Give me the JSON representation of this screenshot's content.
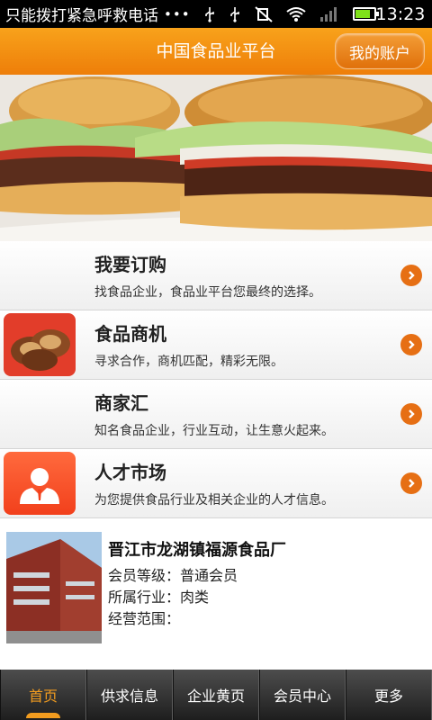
{
  "status_bar": {
    "carrier_text": "只能拨打紧急呼救电话",
    "more_dots": "•••",
    "time": "13:23",
    "icons": [
      "usb-icon",
      "usb-icon",
      "mute-icon",
      "wifi-icon",
      "signal-icon",
      "battery-icon"
    ]
  },
  "header": {
    "title": "中国食品业平台",
    "account_button": "我的账户",
    "accent_color": "#f08c10"
  },
  "banner": {
    "pages": 3,
    "active_page": 1
  },
  "menu": [
    {
      "title": "我要订购",
      "desc": "找食品企业，食品业平台您最终的选择。",
      "thumb": "none"
    },
    {
      "title": "食品商机",
      "desc": "寻求合作，商机匹配，精彩无限。",
      "thumb": "cookies-image"
    },
    {
      "title": "商家汇",
      "desc": "知名食品企业，行业互动，让生意火起来。",
      "thumb": "none"
    },
    {
      "title": "人才市场",
      "desc": "为您提供食品行业及相关企业的人才信息。",
      "thumb": "person-icon"
    }
  ],
  "company": {
    "name": "晋江市龙湖镇福源食品厂",
    "member_level": "会员等级：普通会员",
    "industry": "所属行业：肉类",
    "scope": "经营范围："
  },
  "tabs": [
    {
      "label": "首页",
      "active": true
    },
    {
      "label": "供求信息",
      "active": false
    },
    {
      "label": "企业黄页",
      "active": false
    },
    {
      "label": "会员中心",
      "active": false
    },
    {
      "label": "更多",
      "active": false
    }
  ]
}
